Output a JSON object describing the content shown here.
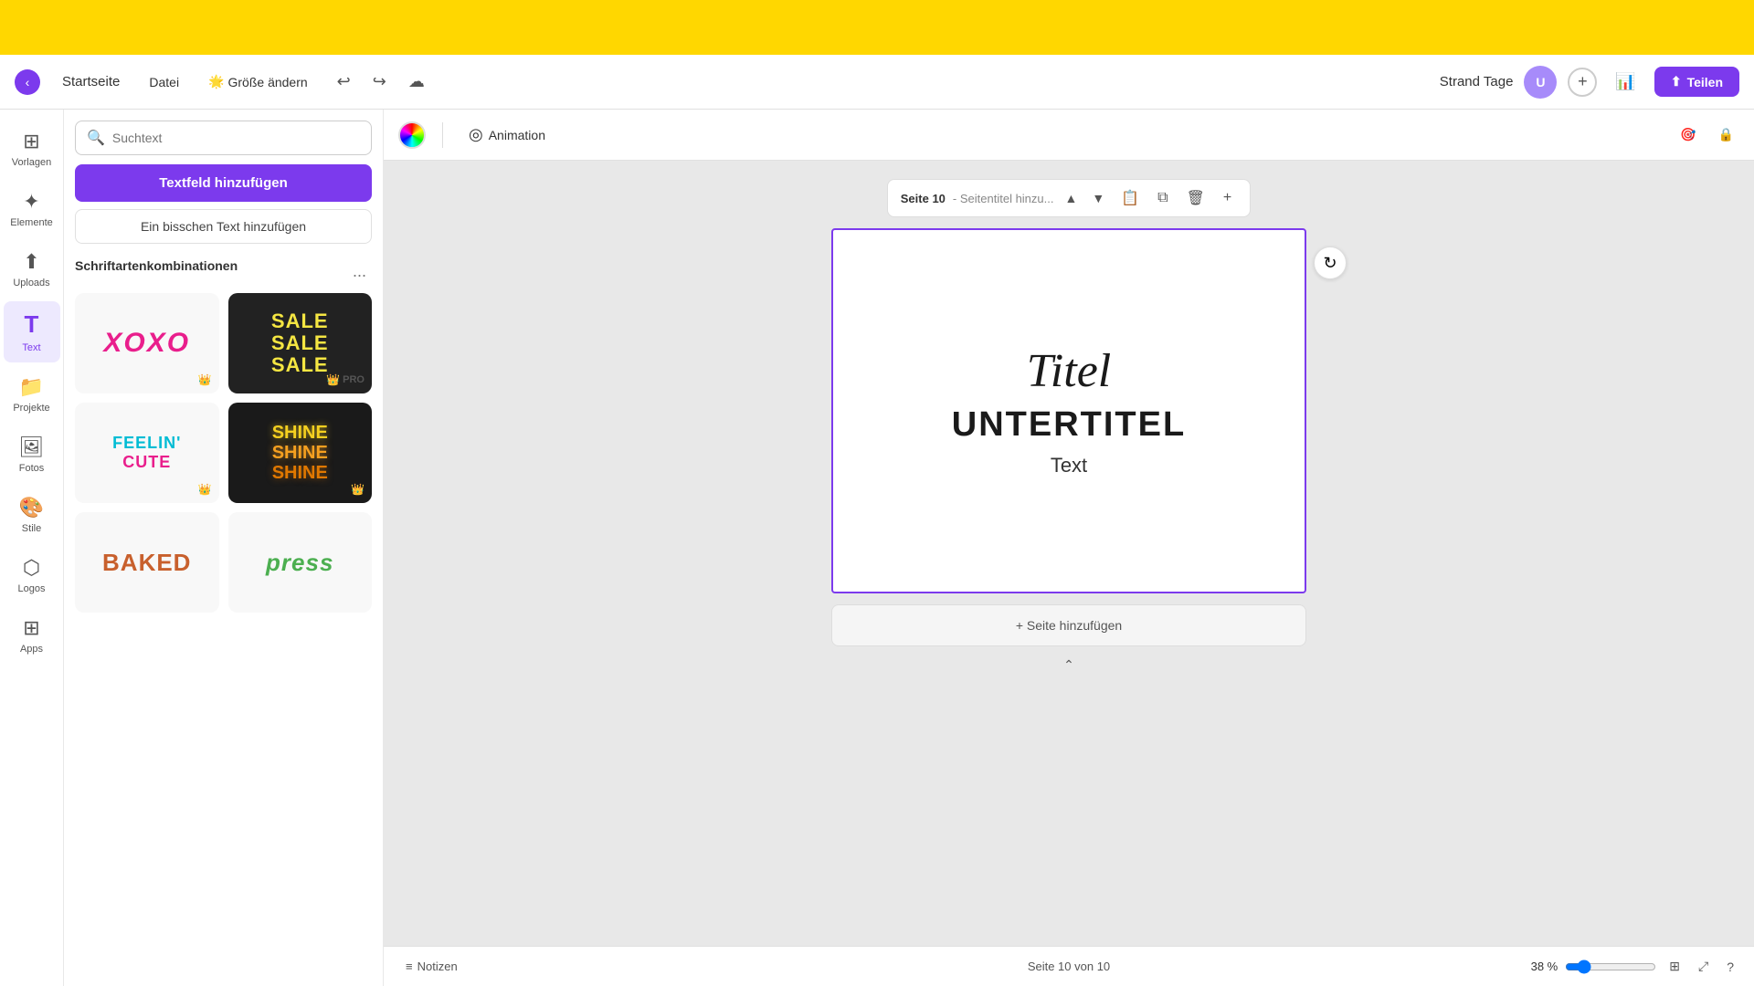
{
  "topBanner": {
    "visible": true
  },
  "navbar": {
    "homeLabel": "Startseite",
    "fileLabel": "Datei",
    "sizeLabel": "Größe ändern",
    "projectName": "Strand Tage",
    "shareLabel": "Teilen",
    "cloudIcon": "☁",
    "undoIcon": "↩",
    "redoIcon": "↪"
  },
  "toolbar": {
    "items": [
      {
        "id": "vorlagen",
        "label": "Vorlagen",
        "icon": "⊞"
      },
      {
        "id": "elemente",
        "label": "Elemente",
        "icon": "✦"
      },
      {
        "id": "uploads",
        "label": "Uploads",
        "icon": "⬆"
      },
      {
        "id": "text",
        "label": "Text",
        "icon": "T",
        "active": true
      },
      {
        "id": "projekte",
        "label": "Projekte",
        "icon": "📁"
      },
      {
        "id": "fotos",
        "label": "Fotos",
        "icon": "🖼"
      },
      {
        "id": "stile",
        "label": "Stile",
        "icon": "🎨"
      },
      {
        "id": "logos",
        "label": "Logos",
        "icon": "⬡"
      },
      {
        "id": "apps",
        "label": "Apps",
        "icon": "⊞"
      }
    ]
  },
  "panel": {
    "searchPlaceholder": "Suchtext",
    "addTextfieldLabel": "Textfeld hinzufügen",
    "addSmallTextLabel": "Ein bisschen Text hinzufügen",
    "sectionTitle": "Schriftartenkombinationen",
    "moreButtonLabel": "...",
    "fontCombos": [
      {
        "id": "xoxo",
        "type": "xoxo",
        "hasCrown": true
      },
      {
        "id": "sale",
        "type": "sale",
        "lines": [
          "SALE",
          "SALE",
          "SALE"
        ],
        "hasCrown": true,
        "isPro": true,
        "proLabel": "PRO"
      },
      {
        "id": "feelin-cute",
        "type": "feelin",
        "line1": "FEELIN'",
        "line2": "CUTE",
        "hasCrown": true
      },
      {
        "id": "shine",
        "type": "shine",
        "lines": [
          "SHINE",
          "SHINE",
          "SHINE"
        ],
        "hasCrown": true
      },
      {
        "id": "baked",
        "type": "baked",
        "text": "BAKED"
      },
      {
        "id": "press",
        "type": "press",
        "text": "press"
      }
    ]
  },
  "canvasToolbar": {
    "animationLabel": "Animation",
    "animationIcon": "◎"
  },
  "pageControls": {
    "pageLabel": "Seite 10",
    "subtitleLabel": "- Seitentitel hinzu...",
    "upIcon": "▲",
    "downIcon": "▼"
  },
  "canvas": {
    "title": "Titel",
    "subtitle": "UNTERTITEL",
    "text": "Text"
  },
  "addPageLabel": "+ Seite hinzufügen",
  "statusBar": {
    "notesLabel": "Notizen",
    "pageInfo": "Seite 10 von 10",
    "zoomPercent": "38 %",
    "notesIcon": "≡",
    "chevronUpIcon": "⌃"
  }
}
